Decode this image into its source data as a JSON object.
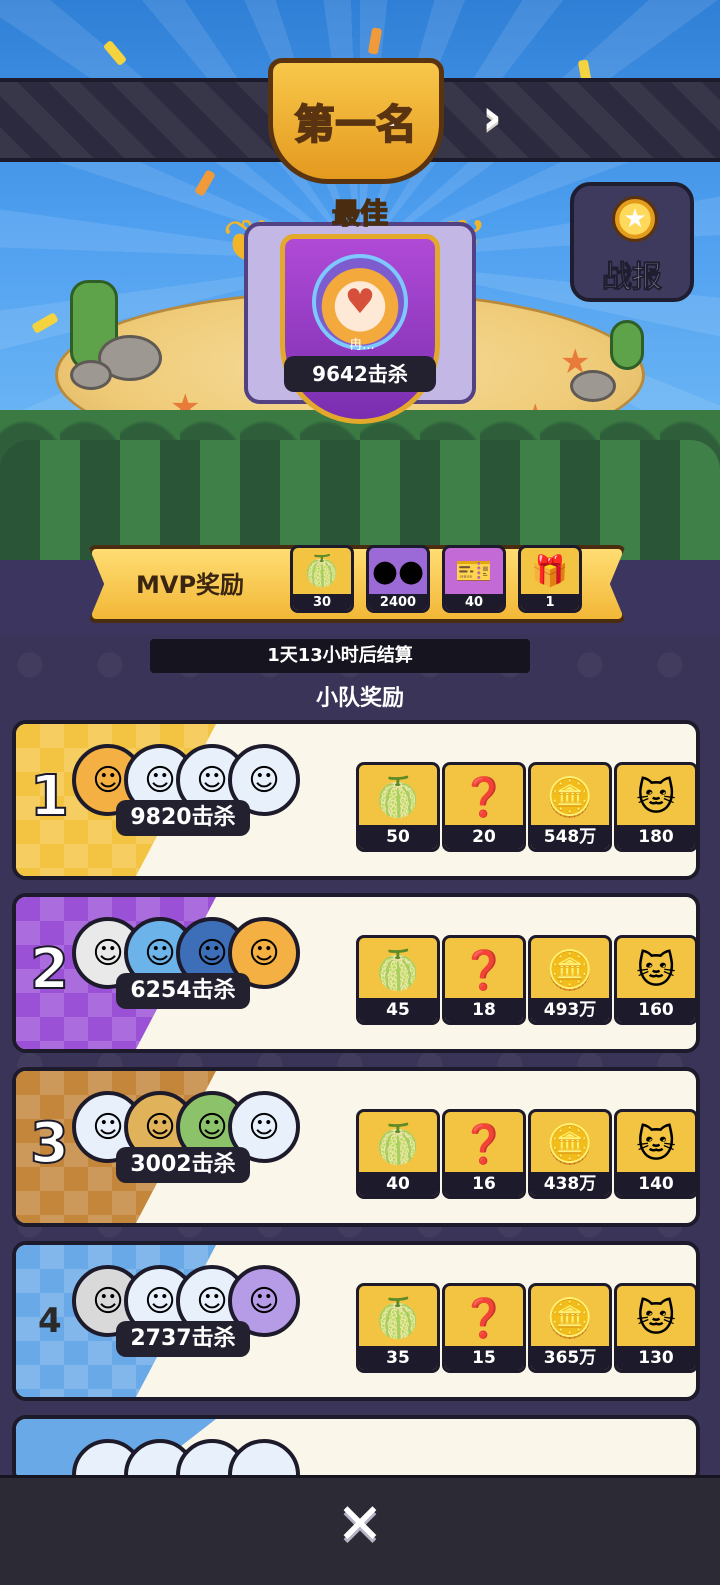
{
  "header": {
    "rank_title": "第一名",
    "best_label": "最佳",
    "battle_report_label": "战报"
  },
  "mvp": {
    "name": "冉...",
    "kills": "9642击杀",
    "reward_label": "MVP奖励",
    "rewards": [
      {
        "icon": "durian-fruit-icon",
        "count": "30"
      },
      {
        "icon": "purple-orbs-icon",
        "count": "2400"
      },
      {
        "icon": "gold-ticket-icon",
        "count": "40"
      },
      {
        "icon": "gift-box-icon",
        "count": "1"
      }
    ]
  },
  "timer": "1天13小时后结算",
  "team_rewards_title": "小队奖励",
  "teams": [
    {
      "rank": "1",
      "kills": "9820击杀",
      "rewards": [
        "50",
        "20",
        "548万",
        "180"
      ]
    },
    {
      "rank": "2",
      "kills": "6254击杀",
      "rewards": [
        "45",
        "18",
        "493万",
        "160"
      ]
    },
    {
      "rank": "3",
      "kills": "3002击杀",
      "rewards": [
        "40",
        "16",
        "438万",
        "140"
      ]
    },
    {
      "rank": "4",
      "kills": "2737击杀",
      "rewards": [
        "35",
        "15",
        "365万",
        "130"
      ]
    }
  ],
  "reward_icons": [
    "durian-fruit-icon",
    "mystery-box-icon",
    "gold-coins-icon",
    "cat-capsule-icon"
  ],
  "colors": {
    "rank1": "#f3c441",
    "rank2": "#9b51d6",
    "rank3": "#c3863b",
    "rank4": "#6aa9e8",
    "panel": "#3a3558",
    "card": "#fbf6ea"
  }
}
